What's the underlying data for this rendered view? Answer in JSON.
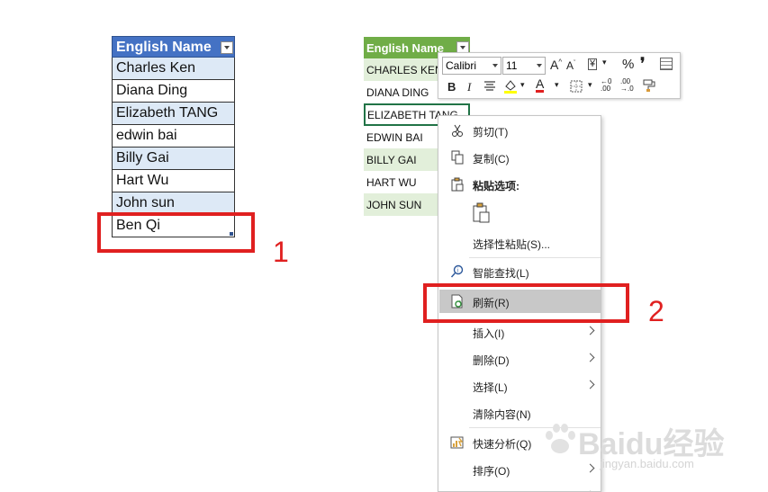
{
  "left_table": {
    "header": "English Name",
    "rows": [
      "Charles Ken",
      "Diana Ding",
      "Elizabeth TANG",
      "edwin bai",
      "Billy Gai",
      "Hart Wu",
      "John sun",
      "Ben Qi"
    ]
  },
  "right_table": {
    "header": "English Name",
    "rows": [
      "CHARLES KEN",
      "DIANA DING",
      "ELIZABETH TANG",
      "EDWIN BAI",
      "BILLY GAI",
      "HART WU",
      "JOHN SUN"
    ]
  },
  "annotations": {
    "label_1": "1",
    "label_2": "2"
  },
  "mini_toolbar": {
    "font_name": "Calibri",
    "font_size": "11",
    "bold": "B",
    "italic": "I",
    "percent": "%",
    "comma": "❜"
  },
  "context_menu": {
    "cut": "剪切(T)",
    "copy": "复制(C)",
    "paste_options": "粘贴选项:",
    "paste_special": "选择性粘贴(S)...",
    "smart_lookup": "智能查找(L)",
    "refresh": "刷新(R)",
    "insert": "插入(I)",
    "delete": "删除(D)",
    "select": "选择(L)",
    "clear_contents": "清除内容(N)",
    "quick_analysis": "快速分析(Q)",
    "sort": "排序(O)"
  },
  "watermark": {
    "brand": "Baidu经验",
    "url": "jingyan.baidu.com"
  },
  "colors": {
    "highlight_red": "#e02020",
    "blue_header": "#4472c4",
    "green_header": "#70ad47"
  }
}
